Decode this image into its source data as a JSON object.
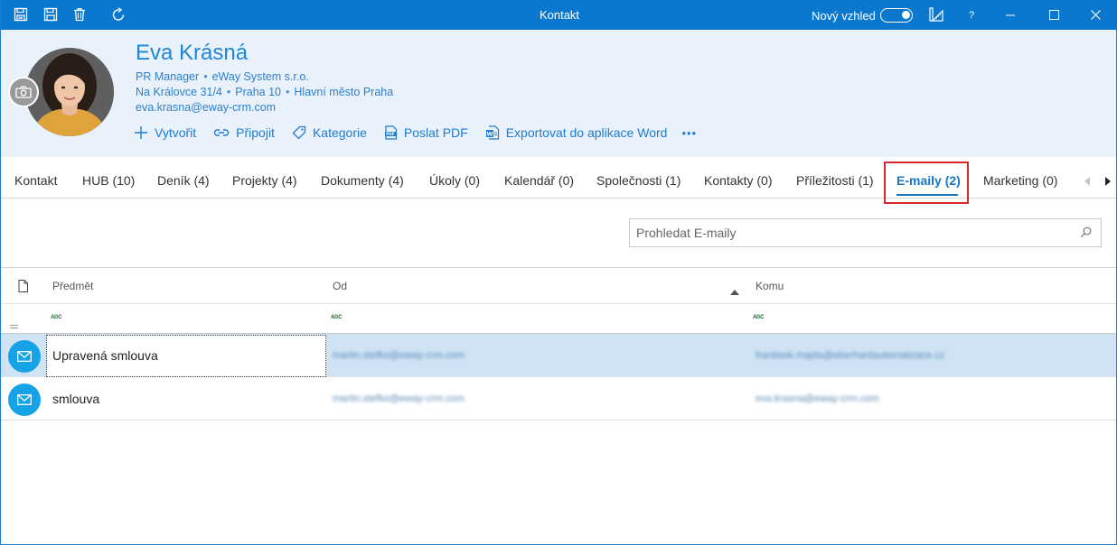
{
  "window": {
    "title": "Kontakt",
    "toggle_label": "Nový vzhled",
    "toggle_on": true,
    "help_label": "?",
    "accent_color": "#0b78d0"
  },
  "contact": {
    "name": "Eva Krásná",
    "position": "PR Manager",
    "company": "eWay System s.r.o.",
    "street": "Na Královce 31/4",
    "district": "Praha 10",
    "city": "Hlavní město Praha",
    "email": "eva.krasna@eway-crm.com",
    "name_color": "#1e86d6"
  },
  "actions": [
    {
      "label": "Vytvořit",
      "icon": "plus-icon"
    },
    {
      "label": "Připojit",
      "icon": "link-icon"
    },
    {
      "label": "Kategorie",
      "icon": "tag-icon"
    },
    {
      "label": "Poslat PDF",
      "icon": "pdf-icon"
    },
    {
      "label": "Exportovat do aplikace Word",
      "icon": "word-export-icon"
    },
    {
      "label": "•••",
      "icon": "more-icon"
    }
  ],
  "tabs": [
    {
      "label": "Kontakt"
    },
    {
      "label": "HUB (10)"
    },
    {
      "label": "Deník (4)"
    },
    {
      "label": "Projekty (4)"
    },
    {
      "label": "Dokumenty (4)"
    },
    {
      "label": "Úkoly (0)"
    },
    {
      "label": "Kalendář (0)"
    },
    {
      "label": "Společnosti (1)"
    },
    {
      "label": "Kontakty (0)"
    },
    {
      "label": "Příležitosti (1)"
    },
    {
      "label": "E-maily (2)",
      "active": true
    },
    {
      "label": "Marketing (0)"
    }
  ],
  "search": {
    "placeholder": "Prohledat E-maily"
  },
  "grid": {
    "columns": [
      "Předmět",
      "Od",
      "Komu"
    ],
    "sorted_column": "Od",
    "sort_direction": "ascending",
    "filter_glyph": "ABC",
    "rows": [
      {
        "subject": "Upravená smlouva",
        "from": "martin.stefko@eway-crm.com",
        "to": "frantisek.majda@eberhardautomatizace.cz",
        "selected": true
      },
      {
        "subject": "smlouva",
        "from": "martin.stefko@eway-crm.com",
        "to": "eva.krasna@eway-crm.com",
        "selected": false
      }
    ]
  },
  "colors": {
    "selected_row": "#cfe3f5",
    "mail_icon": "#15a2e6",
    "active_tab": "#1677c9",
    "highlight_border": "#d9262c"
  }
}
